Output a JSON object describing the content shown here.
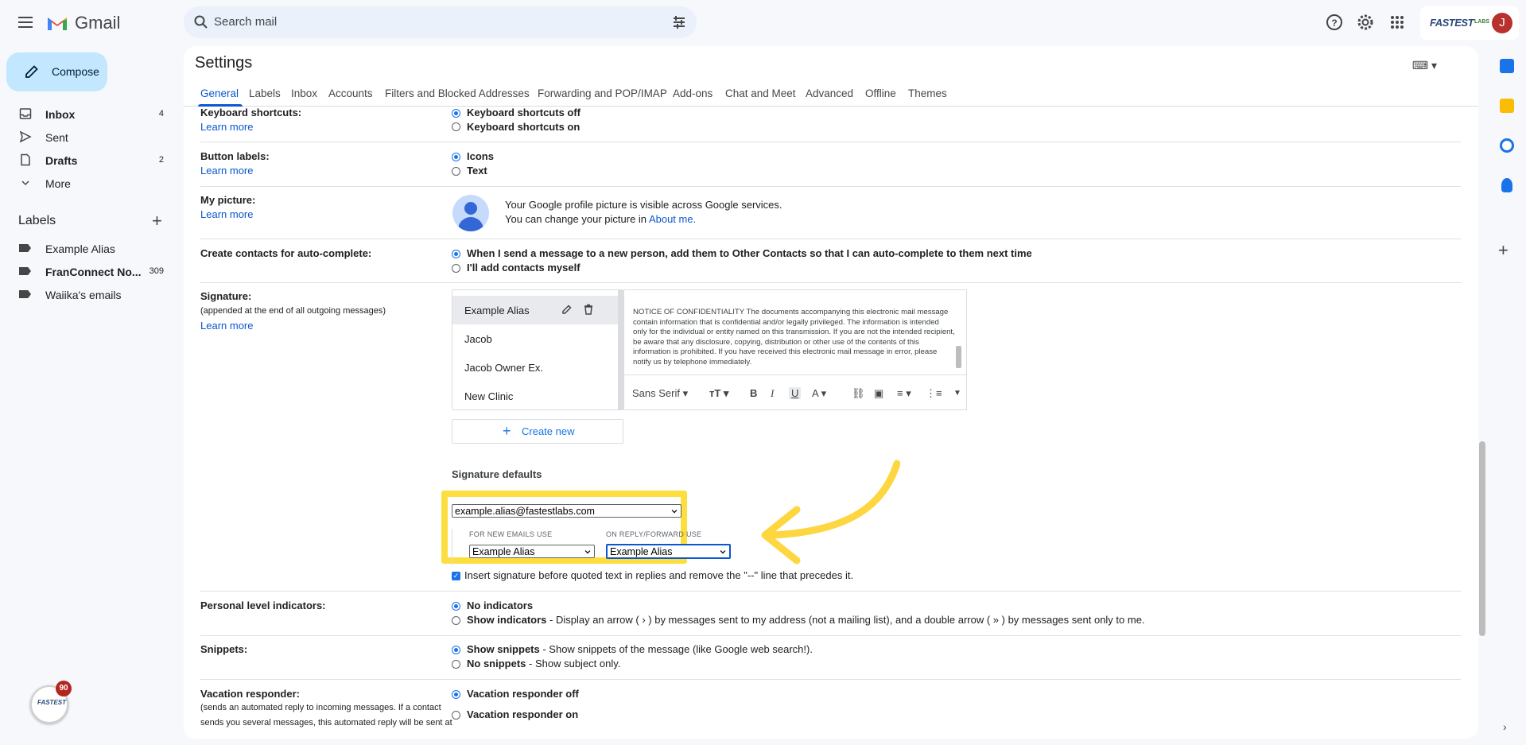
{
  "app": {
    "name": "Gmail"
  },
  "search": {
    "placeholder": "Search mail"
  },
  "account": {
    "logo_text": "FASTEST",
    "logo_sub": "LABS",
    "avatar_initial": "J"
  },
  "sidebar": {
    "compose_label": "Compose",
    "items": [
      {
        "label": "Inbox",
        "count": "4",
        "bold": true,
        "icon": "inbox-icon"
      },
      {
        "label": "Sent",
        "count": "",
        "bold": false,
        "icon": "send-icon"
      },
      {
        "label": "Drafts",
        "count": "2",
        "bold": true,
        "icon": "draft-icon"
      },
      {
        "label": "More",
        "count": "",
        "bold": false,
        "icon": "chevron-down-icon"
      }
    ],
    "labels_header": "Labels",
    "labels": [
      {
        "label": "Example Alias",
        "count": "",
        "bold": false
      },
      {
        "label": "FranConnect No...",
        "count": "309",
        "bold": true
      },
      {
        "label": "Waiika's emails",
        "count": "",
        "bold": false
      }
    ],
    "badge_count": "90",
    "badge_logo": "FASTEST"
  },
  "settings": {
    "title": "Settings",
    "tabs": [
      "General",
      "Labels",
      "Inbox",
      "Accounts",
      "Filters and Blocked Addresses",
      "Forwarding and POP/IMAP",
      "Add-ons",
      "Chat and Meet",
      "Advanced",
      "Offline",
      "Themes"
    ],
    "active_tab": "General",
    "learn_more": "Learn more",
    "keyboard": {
      "label": "Keyboard shortcuts:",
      "opt_off": "Keyboard shortcuts off",
      "opt_on": "Keyboard shortcuts on"
    },
    "button_labels": {
      "label": "Button labels:",
      "opt_icons": "Icons",
      "opt_text": "Text"
    },
    "picture": {
      "label": "My picture:",
      "line1": "Your Google profile picture is visible across Google services.",
      "line2_prefix": "You can change your picture in ",
      "line2_link": "About me."
    },
    "contacts": {
      "label": "Create contacts for auto-complete:",
      "opt1": "When I send a message to a new person, add them to Other Contacts so that I can auto-complete to them next time",
      "opt2": "I'll add contacts myself"
    },
    "signature": {
      "label": "Signature:",
      "sublabel": "(appended at the end of all outgoing messages)",
      "items": [
        "Example Alias",
        "Jacob",
        "Jacob Owner Ex.",
        "New Clinic"
      ],
      "body": "NOTICE OF CONFIDENTIALITY The documents accompanying this electronic mail message contain information that is confidential and/or legally privileged. The information is intended only for the individual or entity named on this transmission. If you are not the intended recipient, be aware that any disclosure, copying, distribution or other use of the contents of this information is prohibited. If you have received this electronic mail message in error, please notify us by telephone immediately.",
      "font": "Sans Serif",
      "create_new": "Create new",
      "defaults_title": "Signature defaults",
      "account_select": "example.alias@fastestlabs.com",
      "new_emails_label": "FOR NEW EMAILS USE",
      "reply_label": "ON REPLY/FORWARD USE",
      "new_emails_value": "Example Alias",
      "reply_value": "Example Alias",
      "insert_before": "Insert signature before quoted text in replies and remove the \"--\" line that precedes it."
    },
    "personal_indicators": {
      "label": "Personal level indicators:",
      "opt1_bold": "No indicators",
      "opt2_bold": "Show indicators",
      "opt2_rest": " - Display an arrow ( › ) by messages sent to my address (not a mailing list), and a double arrow ( » ) by messages sent only to me."
    },
    "snippets": {
      "label": "Snippets:",
      "opt1_bold": "Show snippets",
      "opt1_rest": " - Show snippets of the message (like Google web search!).",
      "opt2_bold": "No snippets",
      "opt2_rest": " - Show subject only."
    },
    "vacation": {
      "label": "Vacation responder:",
      "sub1": "(sends an automated reply to incoming messages. If a contact",
      "sub2": "sends you several messages, this automated reply will be sent at",
      "opt_off": "Vacation responder off",
      "opt_on": "Vacation responder on"
    }
  },
  "colors": {
    "accent": "#0b57d0",
    "highlight": "#fdde3f",
    "compose_bg": "#c2e7ff"
  }
}
